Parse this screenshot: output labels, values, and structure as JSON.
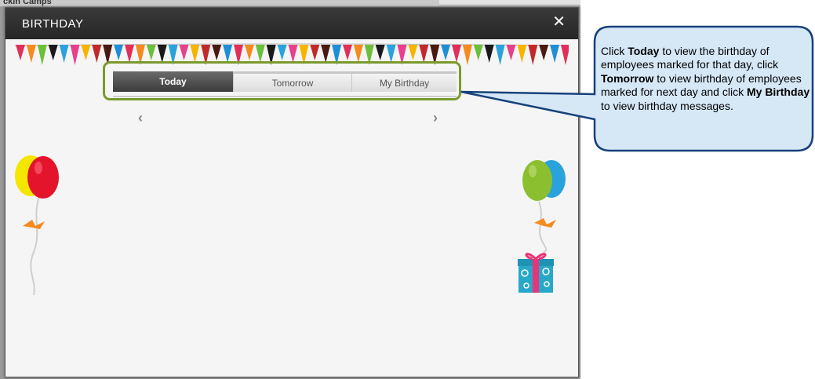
{
  "background": {
    "top_label": "ckin Camps"
  },
  "modal": {
    "title": "BIRTHDAY",
    "close_glyph": "✕"
  },
  "tabs": [
    {
      "label": "Today",
      "active": true
    },
    {
      "label": "Tomorrow",
      "active": false
    },
    {
      "label": "My Birthday",
      "active": false
    }
  ],
  "nav": {
    "prev_glyph": "‹",
    "next_glyph": "›"
  },
  "callout": {
    "p1": "Click ",
    "k1": "Today",
    "p2": " to view the birthday of employees marked for that day, click ",
    "k2": "Tomorrow",
    "p3": " to view  birthday of employees  marked for next day and click ",
    "k3": "My Birthday",
    "p4": " to view birthday messages."
  },
  "colors": {
    "accent_frame": "#7a9a2e",
    "callout_fill": "#d6e7f6",
    "callout_border": "#17427a",
    "header_bg": "#2e2e2e",
    "modal_bg": "#f5f5f5"
  },
  "icons": [
    "close-icon",
    "chevron-left-icon",
    "chevron-right-icon",
    "balloon-icon",
    "gift-icon",
    "bunting-flags"
  ]
}
